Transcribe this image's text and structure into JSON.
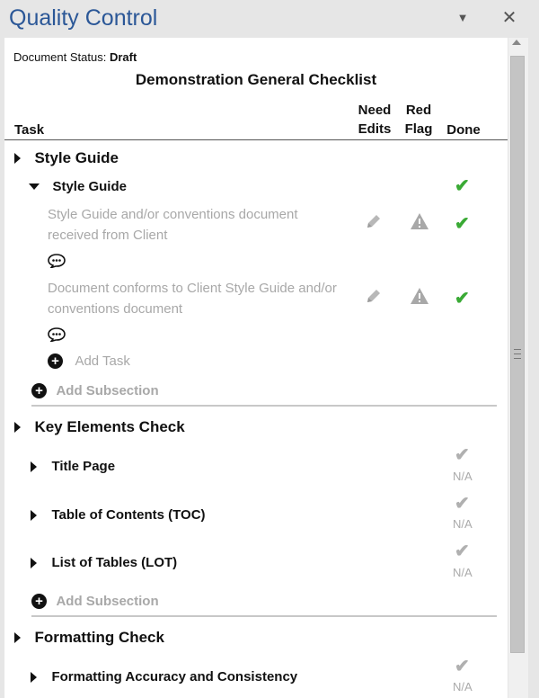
{
  "pane": {
    "title": "Quality Control",
    "menu_icon": "▼",
    "close_icon": "✕"
  },
  "status": {
    "label": "Document Status:",
    "value": "Draft"
  },
  "checklist_title": "Demonstration General Checklist",
  "columns": {
    "task": "Task",
    "need_edits_1": "Need",
    "need_edits_2": "Edits",
    "red_flag_1": "Red",
    "red_flag_2": "Flag",
    "done": "Done"
  },
  "sections": {
    "style_guide": {
      "label": "Style Guide",
      "sub": {
        "label": "Style Guide"
      },
      "task1": "Style Guide and/or conventions document received from Client",
      "task2": "Document conforms to Client Style Guide and/or conventions document",
      "add_task": "Add Task",
      "add_subsection": "Add Subsection"
    },
    "key_elements": {
      "label": "Key Elements Check",
      "sub1": "Title Page",
      "sub2": "Table of Contents (TOC)",
      "sub3": "List of Tables (LOT)",
      "add_subsection": "Add Subsection"
    },
    "formatting": {
      "label": "Formatting Check",
      "sub1": "Formatting Accuracy and Consistency"
    }
  },
  "na_label": "N/A",
  "icons": {
    "check": "✔",
    "pencil": "pencil-icon",
    "warning": "warning-icon",
    "comment": "comment-icon",
    "add": "+"
  },
  "colors": {
    "title_blue": "#2b5797",
    "check_green": "#3aaa35",
    "muted": "#a8a8a8"
  }
}
